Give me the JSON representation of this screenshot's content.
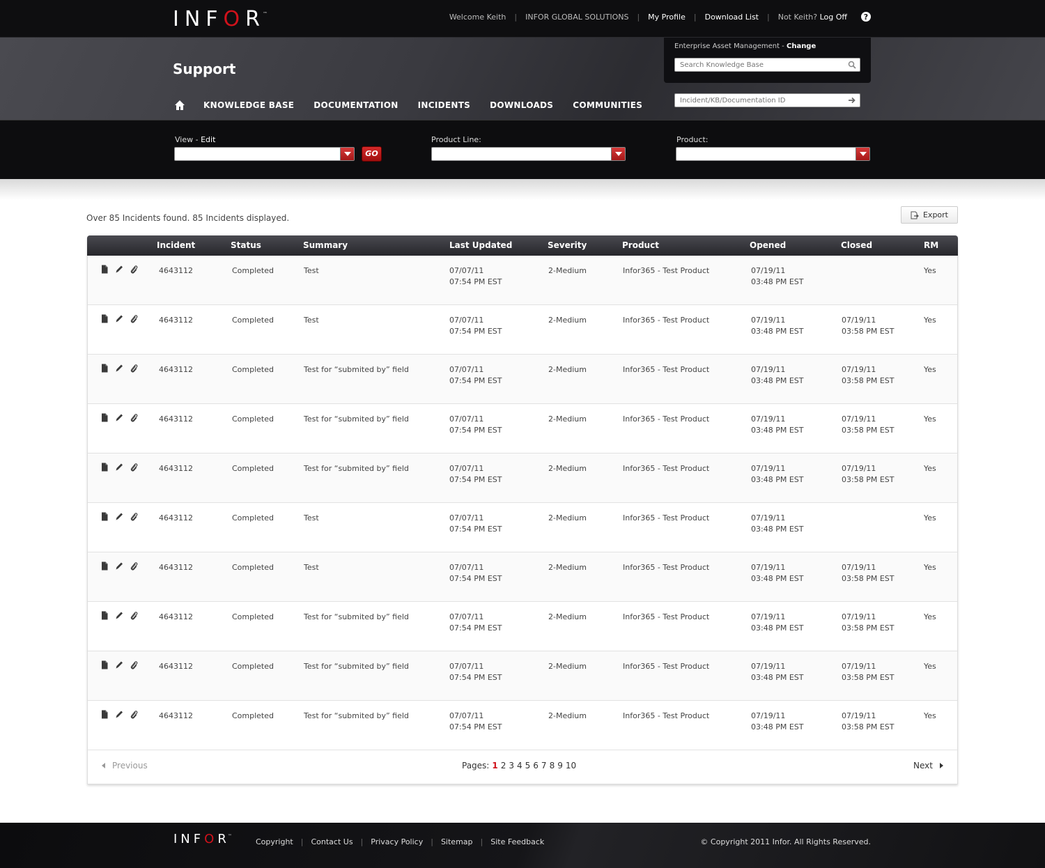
{
  "brand": {
    "logo_pre": "INF",
    "logo_o": "O",
    "logo_post": "R",
    "tm": "™",
    "accent": "#d0121b"
  },
  "topnav": {
    "welcome": "Welcome Keith",
    "company": "INFOR GLOBAL SOLUTIONS",
    "my_profile": "My Profile",
    "download_list": "Download List",
    "not_user": "Not Keith?",
    "log_off": "Log Off",
    "help": "?"
  },
  "header": {
    "title": "Support",
    "nav": [
      "KNOWLEDGE BASE",
      "DOCUMENTATION",
      "INCIDENTS",
      "DOWNLOADS",
      "COMMUNITIES"
    ],
    "eam_label": "Enterprise Asset Management -",
    "eam_change": "Change",
    "search_placeholder": "Search Knowledge Base",
    "id_placeholder": "Incident/KB/Documentation ID"
  },
  "filters": {
    "view_label": "View -",
    "view_edit": "Edit",
    "go_label": "GO",
    "product_line_label": "Product Line:",
    "product_label": "Product:"
  },
  "results": {
    "summary": "Over 85 Incidents found. 85 Incidents displayed.",
    "export_label": "Export",
    "columns": [
      "Incident",
      "Status",
      "Summary",
      "Last Updated",
      "Severity",
      "Product",
      "Opened",
      "Closed",
      "RM"
    ],
    "rows": [
      {
        "incident": "4643112",
        "status": "Completed",
        "summary": "Test",
        "updated_date": "07/07/11",
        "updated_time": "07:54 PM EST",
        "severity": "2-Medium",
        "product": "Infor365 - Test Product",
        "opened_date": "07/19/11",
        "opened_time": "03:48 PM EST",
        "closed_date": "",
        "closed_time": "",
        "rm": "Yes"
      },
      {
        "incident": "4643112",
        "status": "Completed",
        "summary": "Test",
        "updated_date": "07/07/11",
        "updated_time": "07:54 PM EST",
        "severity": "2-Medium",
        "product": "Infor365 - Test Product",
        "opened_date": "07/19/11",
        "opened_time": "03:48 PM EST",
        "closed_date": "07/19/11",
        "closed_time": "03:58 PM EST",
        "rm": "Yes"
      },
      {
        "incident": "4643112",
        "status": "Completed",
        "summary": "Test for “submited by” field",
        "updated_date": "07/07/11",
        "updated_time": "07:54 PM EST",
        "severity": "2-Medium",
        "product": "Infor365 - Test Product",
        "opened_date": "07/19/11",
        "opened_time": "03:48 PM EST",
        "closed_date": "07/19/11",
        "closed_time": "03:58 PM EST",
        "rm": "Yes"
      },
      {
        "incident": "4643112",
        "status": "Completed",
        "summary": "Test for “submited by” field",
        "updated_date": "07/07/11",
        "updated_time": "07:54 PM EST",
        "severity": "2-Medium",
        "product": "Infor365 - Test Product",
        "opened_date": "07/19/11",
        "opened_time": "03:48 PM EST",
        "closed_date": "07/19/11",
        "closed_time": "03:58 PM EST",
        "rm": "Yes"
      },
      {
        "incident": "4643112",
        "status": "Completed",
        "summary": "Test for “submited by” field",
        "updated_date": "07/07/11",
        "updated_time": "07:54 PM EST",
        "severity": "2-Medium",
        "product": "Infor365 - Test Product",
        "opened_date": "07/19/11",
        "opened_time": "03:48 PM EST",
        "closed_date": "07/19/11",
        "closed_time": "03:58 PM EST",
        "rm": "Yes"
      },
      {
        "incident": "4643112",
        "status": "Completed",
        "summary": "Test",
        "updated_date": "07/07/11",
        "updated_time": "07:54 PM EST",
        "severity": "2-Medium",
        "product": "Infor365 - Test Product",
        "opened_date": "07/19/11",
        "opened_time": "03:48 PM EST",
        "closed_date": "",
        "closed_time": "",
        "rm": "Yes"
      },
      {
        "incident": "4643112",
        "status": "Completed",
        "summary": "Test",
        "updated_date": "07/07/11",
        "updated_time": "07:54 PM EST",
        "severity": "2-Medium",
        "product": "Infor365 - Test Product",
        "opened_date": "07/19/11",
        "opened_time": "03:48 PM EST",
        "closed_date": "07/19/11",
        "closed_time": "03:58 PM EST",
        "rm": "Yes"
      },
      {
        "incident": "4643112",
        "status": "Completed",
        "summary": "Test for “submited by” field",
        "updated_date": "07/07/11",
        "updated_time": "07:54 PM EST",
        "severity": "2-Medium",
        "product": "Infor365 - Test Product",
        "opened_date": "07/19/11",
        "opened_time": "03:48 PM EST",
        "closed_date": "07/19/11",
        "closed_time": "03:58 PM EST",
        "rm": "Yes"
      },
      {
        "incident": "4643112",
        "status": "Completed",
        "summary": "Test for “submited by” field",
        "updated_date": "07/07/11",
        "updated_time": "07:54 PM EST",
        "severity": "2-Medium",
        "product": "Infor365 - Test Product",
        "opened_date": "07/19/11",
        "opened_time": "03:48 PM EST",
        "closed_date": "07/19/11",
        "closed_time": "03:58 PM EST",
        "rm": "Yes"
      },
      {
        "incident": "4643112",
        "status": "Completed",
        "summary": "Test for “submited by” field",
        "updated_date": "07/07/11",
        "updated_time": "07:54 PM EST",
        "severity": "2-Medium",
        "product": "Infor365 - Test Product",
        "opened_date": "07/19/11",
        "opened_time": "03:48 PM EST",
        "closed_date": "07/19/11",
        "closed_time": "03:58 PM EST",
        "rm": "Yes"
      }
    ],
    "row_icons": [
      "document-icon",
      "pencil-icon",
      "paperclip-icon"
    ]
  },
  "pager": {
    "previous": "Previous",
    "pages_label": "Pages:",
    "pages": [
      "1",
      "2",
      "3",
      "4",
      "5",
      "6",
      "7",
      "8",
      "9",
      "10"
    ],
    "current": "1",
    "next": "Next"
  },
  "footer": {
    "links": [
      "Copyright",
      "Contact Us",
      "Privacy Policy",
      "Sitemap",
      "Site Feedback"
    ],
    "copyright": "© Copyright  2011 Infor. All Rights Reserved."
  }
}
